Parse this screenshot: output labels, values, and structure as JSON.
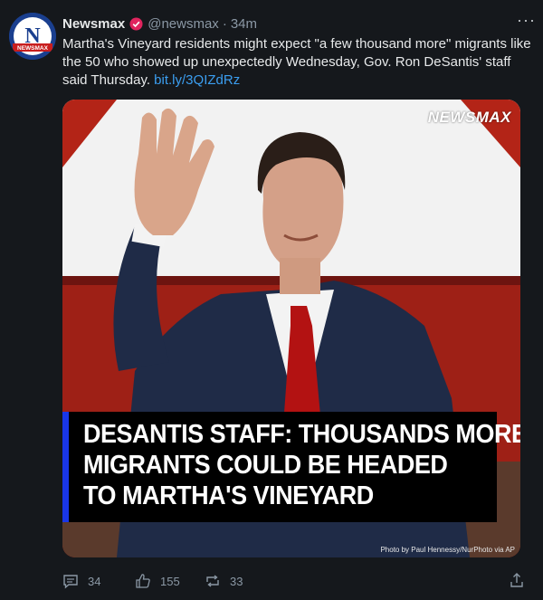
{
  "tweet": {
    "author_name": "Newsmax",
    "handle": "@newsmax",
    "separator": "·",
    "time": "34m",
    "avatar_letter": "N",
    "avatar_label": "NEWSMAX",
    "text": "Martha's Vineyard residents might expect \"a few thousand more\" migrants like the 50 who showed up unexpectedly Wednesday, Gov. Ron DeSantis' staff said Thursday. ",
    "link": "bit.ly/3QIZdRz",
    "more": "···"
  },
  "media": {
    "watermark": "NEWSMAX",
    "headline_lines": [
      "DESANTIS STAFF: THOUSANDS MORE",
      "MIGRANTS COULD BE HEADED",
      "TO MARTHA'S VINEYARD"
    ],
    "credit": "Photo by Paul Hennessy/NurPhoto via AP"
  },
  "actions": {
    "replies": "34",
    "likes": "155",
    "retweets": "33"
  },
  "colors": {
    "background": "#15181c",
    "link": "#3b9ef0",
    "verified": "#e0245e",
    "headline_accent": "#1936e8"
  }
}
